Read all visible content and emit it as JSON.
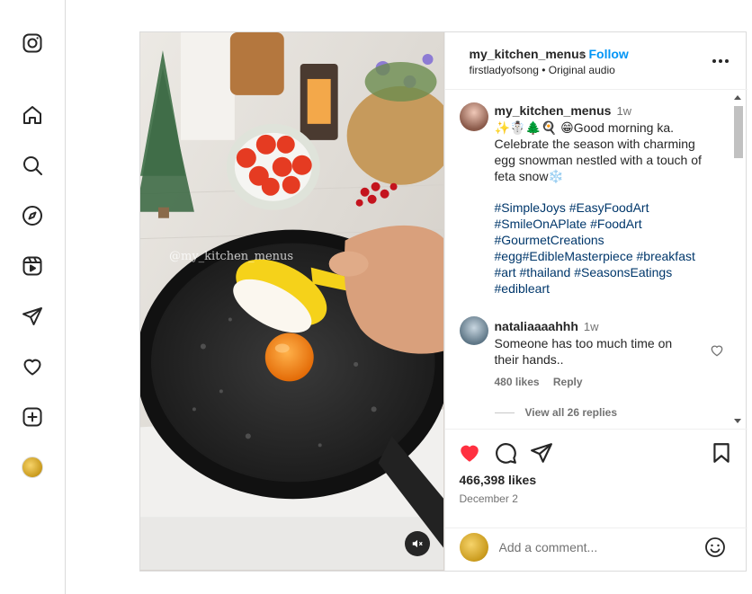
{
  "colors": {
    "like_red": "#ff3040",
    "follow_blue": "#0095f6",
    "hashtag_blue": "#00376b",
    "secondary": "#737373"
  },
  "nav": {
    "items": [
      {
        "name": "instagram-logo-icon",
        "icon": "instagram-logo"
      },
      {
        "name": "home-icon",
        "icon": "home"
      },
      {
        "name": "search-icon",
        "icon": "search"
      },
      {
        "name": "explore-icon",
        "icon": "compass"
      },
      {
        "name": "reels-icon",
        "icon": "reels"
      },
      {
        "name": "messages-icon",
        "icon": "paper-plane"
      },
      {
        "name": "notifications-icon",
        "icon": "heart"
      },
      {
        "name": "create-icon",
        "icon": "plus-square"
      },
      {
        "name": "profile-avatar",
        "icon": "avatar"
      }
    ]
  },
  "post": {
    "watermark": "@my_kitchen_menus",
    "header": {
      "username": "my_kitchen_menus",
      "separator": "•",
      "follow_label": "Follow",
      "audio": "firstladyofsong • Original audio"
    },
    "caption": {
      "username": "my_kitchen_menus",
      "time": "1w",
      "text": "✨☃️🌲🍳 😁Good morning ka. Celebrate the season with charming egg snowman nestled with a touch of feta snow❄️",
      "hashtags": "#SimpleJoys #EasyFoodArt #SmileOnAPlate #FoodArt #GourmetCreations #egg#EdibleMasterpiece #breakfast #art #thailand #SeasonsEatings #edibleart"
    },
    "comment": {
      "username": "nataliaaaahhh",
      "time": "1w",
      "text": "Someone has too much time on their hands..",
      "likes": "480 likes",
      "reply_label": "Reply",
      "view_replies": "View all 26 replies"
    },
    "likes": "466,398 likes",
    "date": "December 2",
    "add_comment_placeholder": "Add a comment..."
  }
}
